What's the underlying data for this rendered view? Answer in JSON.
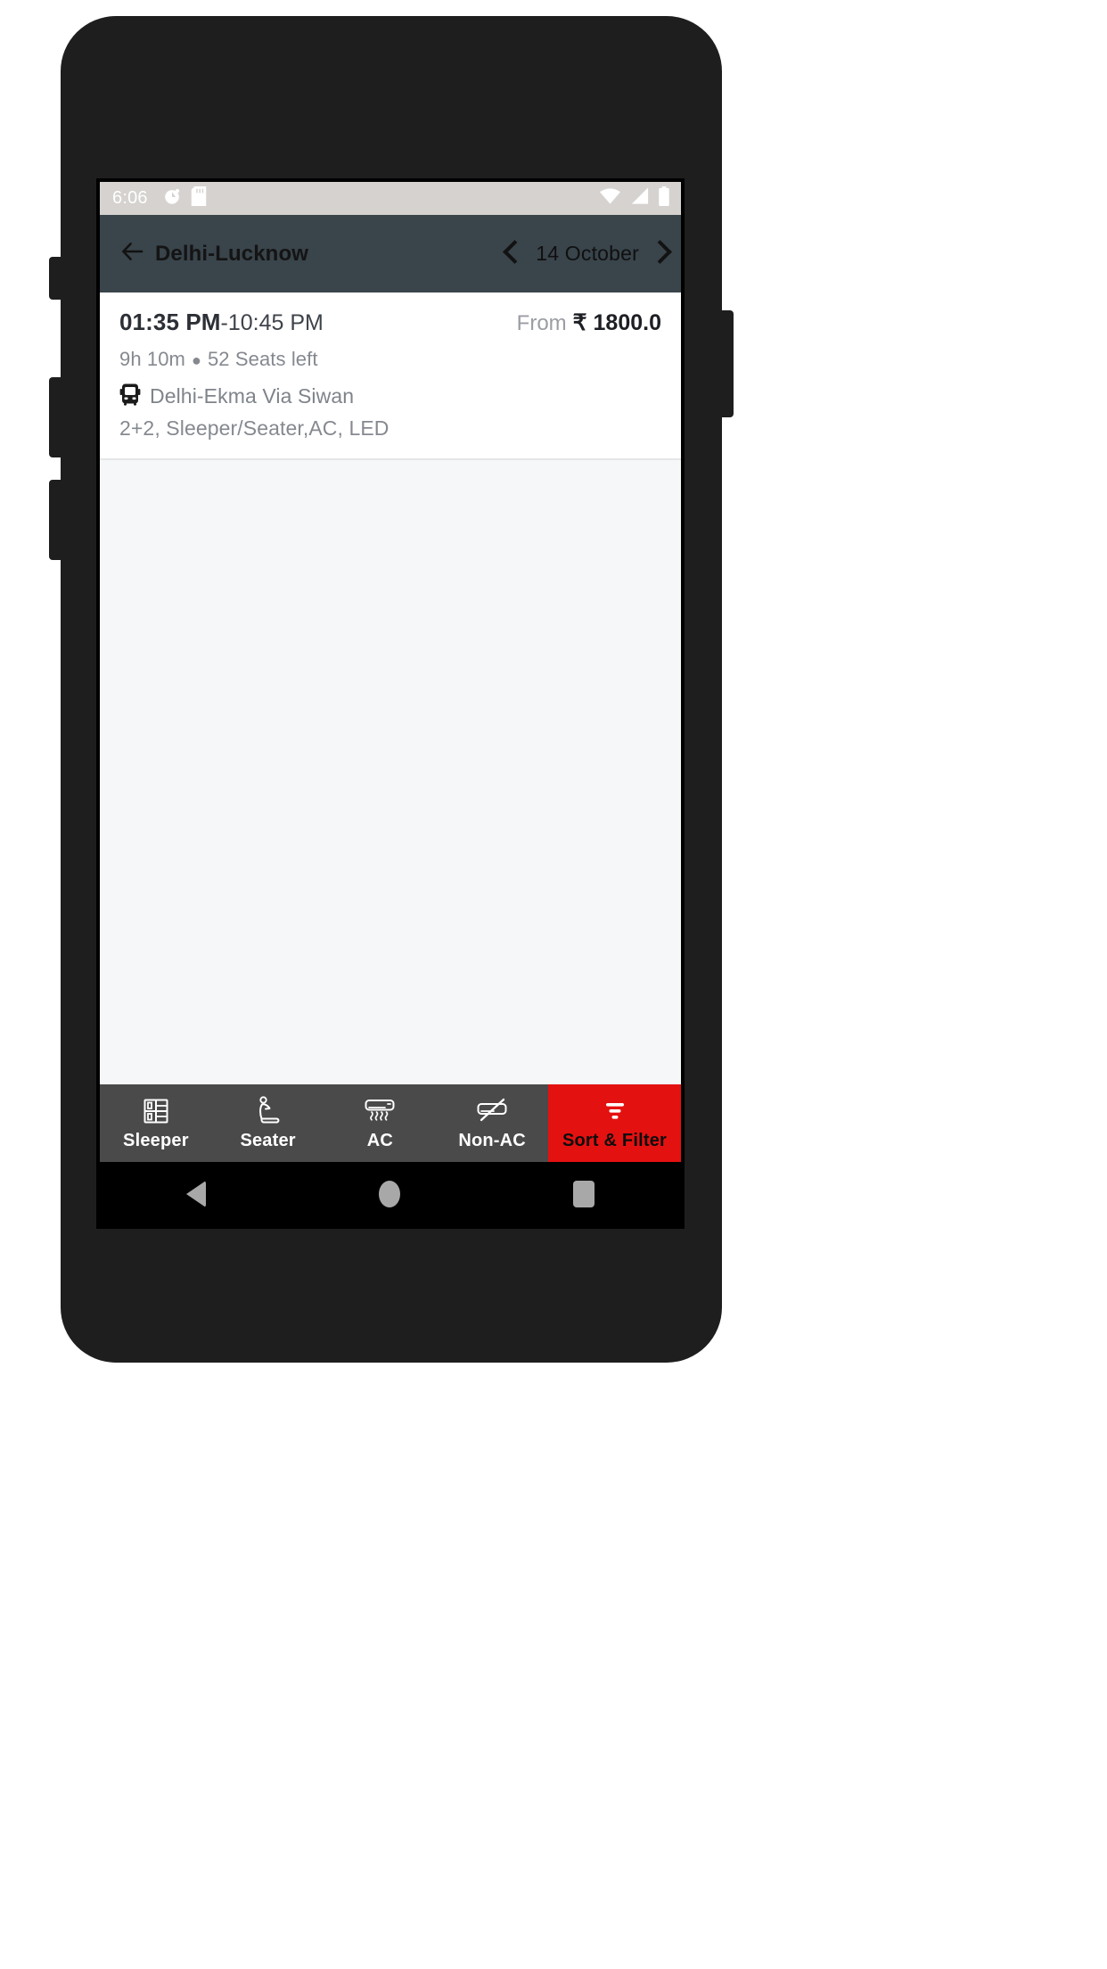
{
  "status_bar": {
    "time": "6:06",
    "left_icons": [
      "alarm-icon",
      "sd-card-icon"
    ],
    "right_icons": [
      "wifi-icon",
      "signal-icon",
      "battery-icon"
    ],
    "background": "#d5d2cf"
  },
  "app_bar": {
    "back_icon": "back-arrow-icon",
    "title": "Delhi-Lucknow",
    "prev_icon": "chevron-left-icon",
    "date": "14 October",
    "next_icon": "chevron-right-icon",
    "background": "#39444b"
  },
  "results": [
    {
      "departure_time": "01:35 PM",
      "separator": "-",
      "arrival_time": "10:45 PM",
      "fare_prefix": "From",
      "fare": "₹ 1800.0",
      "duration": "9h 10m",
      "seats": "52 Seats left",
      "bus_icon": "bus-icon",
      "route": "Delhi-Ekma Via Siwan",
      "amenities": "2+2, Sleeper/Seater,AC, LED"
    }
  ],
  "filter_bar": {
    "background": "#4a4a4a",
    "accent_color": "#e41111",
    "items": [
      {
        "label": "Sleeper",
        "icon": "sleeper-berth-icon",
        "accent": false
      },
      {
        "label": "Seater",
        "icon": "seat-icon",
        "accent": false
      },
      {
        "label": "AC",
        "icon": "air-conditioner-icon",
        "accent": false
      },
      {
        "label": "Non-AC",
        "icon": "air-conditioner-off-icon",
        "accent": false
      },
      {
        "label": "Sort & Filter",
        "icon": "filter-icon",
        "accent": true
      }
    ]
  },
  "nav_bar": {
    "back": "nav-back-icon",
    "home": "nav-home-icon",
    "recents": "nav-recents-icon"
  }
}
